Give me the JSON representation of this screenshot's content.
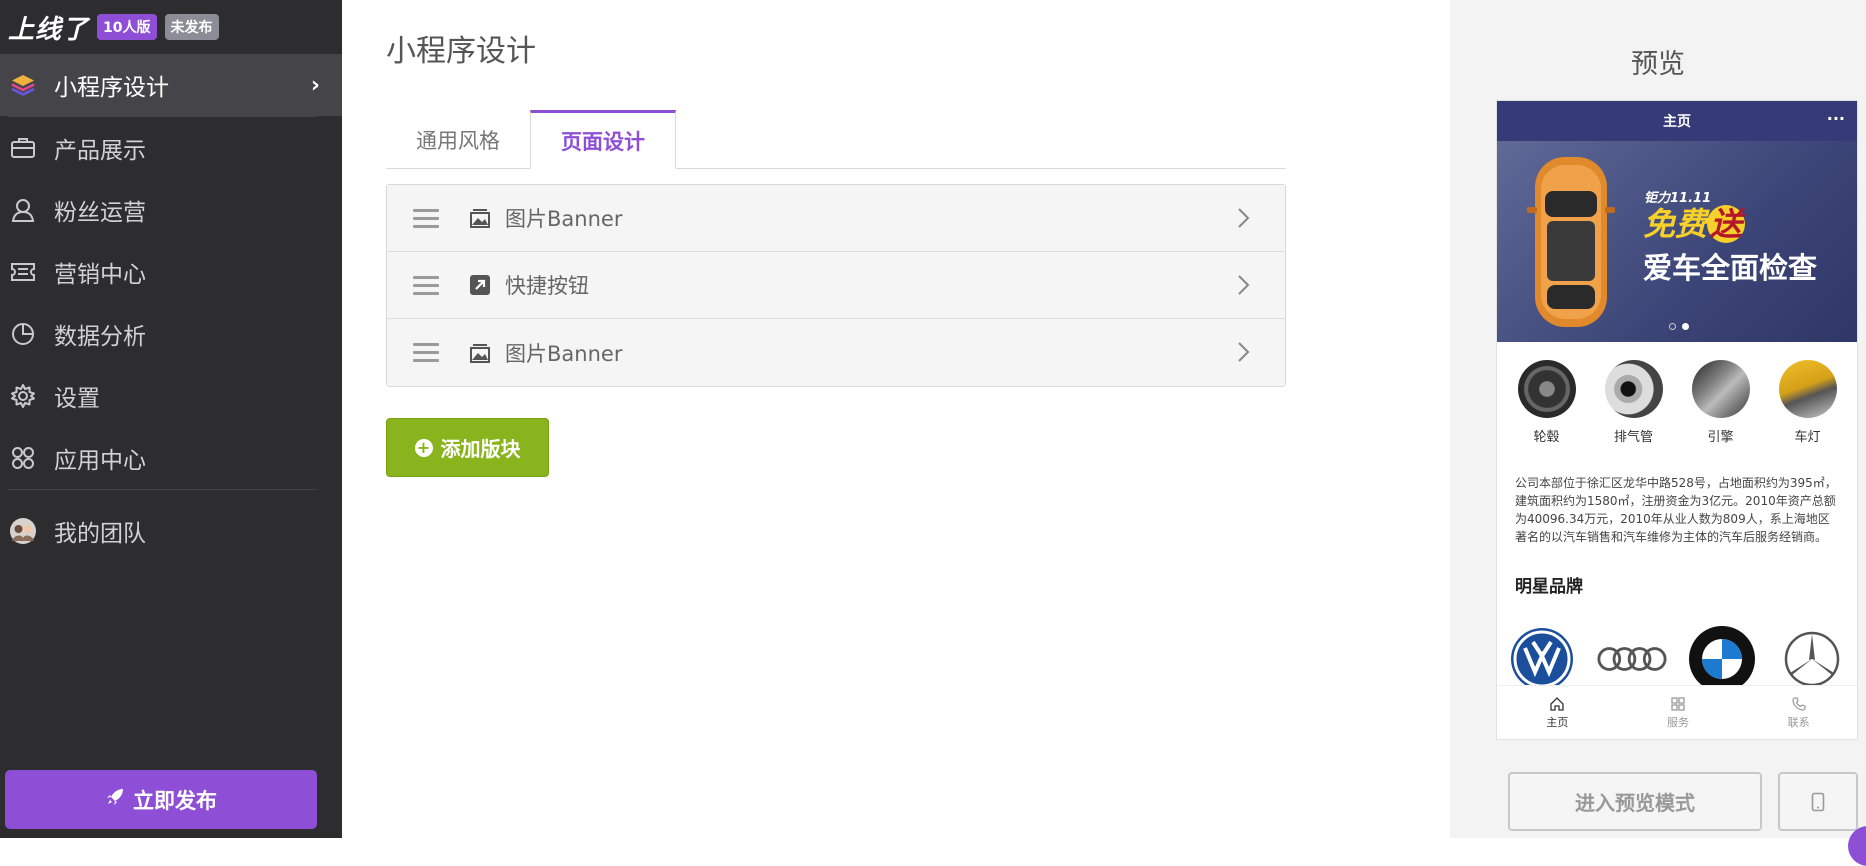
{
  "sidebar": {
    "logo": "上线了",
    "edition_badge": "10人版",
    "status_badge": "未发布",
    "active_item": {
      "label": "小程序设计",
      "icon": "layers-icon"
    },
    "items": [
      {
        "label": "产品展示",
        "icon": "briefcase-icon"
      },
      {
        "label": "粉丝运营",
        "icon": "user-icon"
      },
      {
        "label": "营销中心",
        "icon": "ticket-icon"
      },
      {
        "label": "数据分析",
        "icon": "pie-chart-icon"
      },
      {
        "label": "设置",
        "icon": "gear-icon"
      },
      {
        "label": "应用中心",
        "icon": "apps-grid-icon"
      }
    ],
    "team": {
      "label": "我的团队",
      "icon": "avatar"
    },
    "publish_button": "立即发布"
  },
  "main": {
    "title": "小程序设计",
    "tabs": [
      {
        "label": "通用风格",
        "active": false
      },
      {
        "label": "页面设计",
        "active": true
      }
    ],
    "blocks": [
      {
        "label": "图片Banner",
        "icon": "image-icon"
      },
      {
        "label": "快捷按钮",
        "icon": "shortcut-icon"
      },
      {
        "label": "图片Banner",
        "icon": "image-icon"
      }
    ],
    "add_button": "添加版块"
  },
  "preview": {
    "title": "预览",
    "phone": {
      "header_title": "主页",
      "header_more": "···",
      "banner": {
        "tag": "钜力11.11",
        "headline_prefix": "免费",
        "headline_highlight": "送",
        "subline": "爱车全面检查"
      },
      "shortcuts": [
        {
          "label": "轮毂"
        },
        {
          "label": "排气管"
        },
        {
          "label": "引擎"
        },
        {
          "label": "车灯"
        }
      ],
      "about_text": "公司本部位于徐汇区龙华中路528号，占地面积约为395㎡，建筑面积约为1580㎡，注册资金为3亿元。2010年资产总额为40096.34万元，2010年从业人数为809人，系上海地区著名的以汽车销售和汽车维修为主体的汽车后服务经销商。",
      "brands_title": "明星品牌",
      "brands": [
        "volkswagen",
        "audi",
        "bmw",
        "mercedes-benz"
      ],
      "tabbar": [
        {
          "label": "主页",
          "icon": "home-icon",
          "active": true
        },
        {
          "label": "服务",
          "icon": "grid-icon",
          "active": false
        },
        {
          "label": "联系",
          "icon": "phone-icon",
          "active": false
        }
      ]
    },
    "enter_preview_button": "进入预览模式",
    "device_button_icon": "mobile-icon"
  },
  "colors": {
    "sidebar_bg": "#2d2d30",
    "accent": "#8e4fd6",
    "add_button": "#8ab41e",
    "phone_header": "#363b78"
  }
}
